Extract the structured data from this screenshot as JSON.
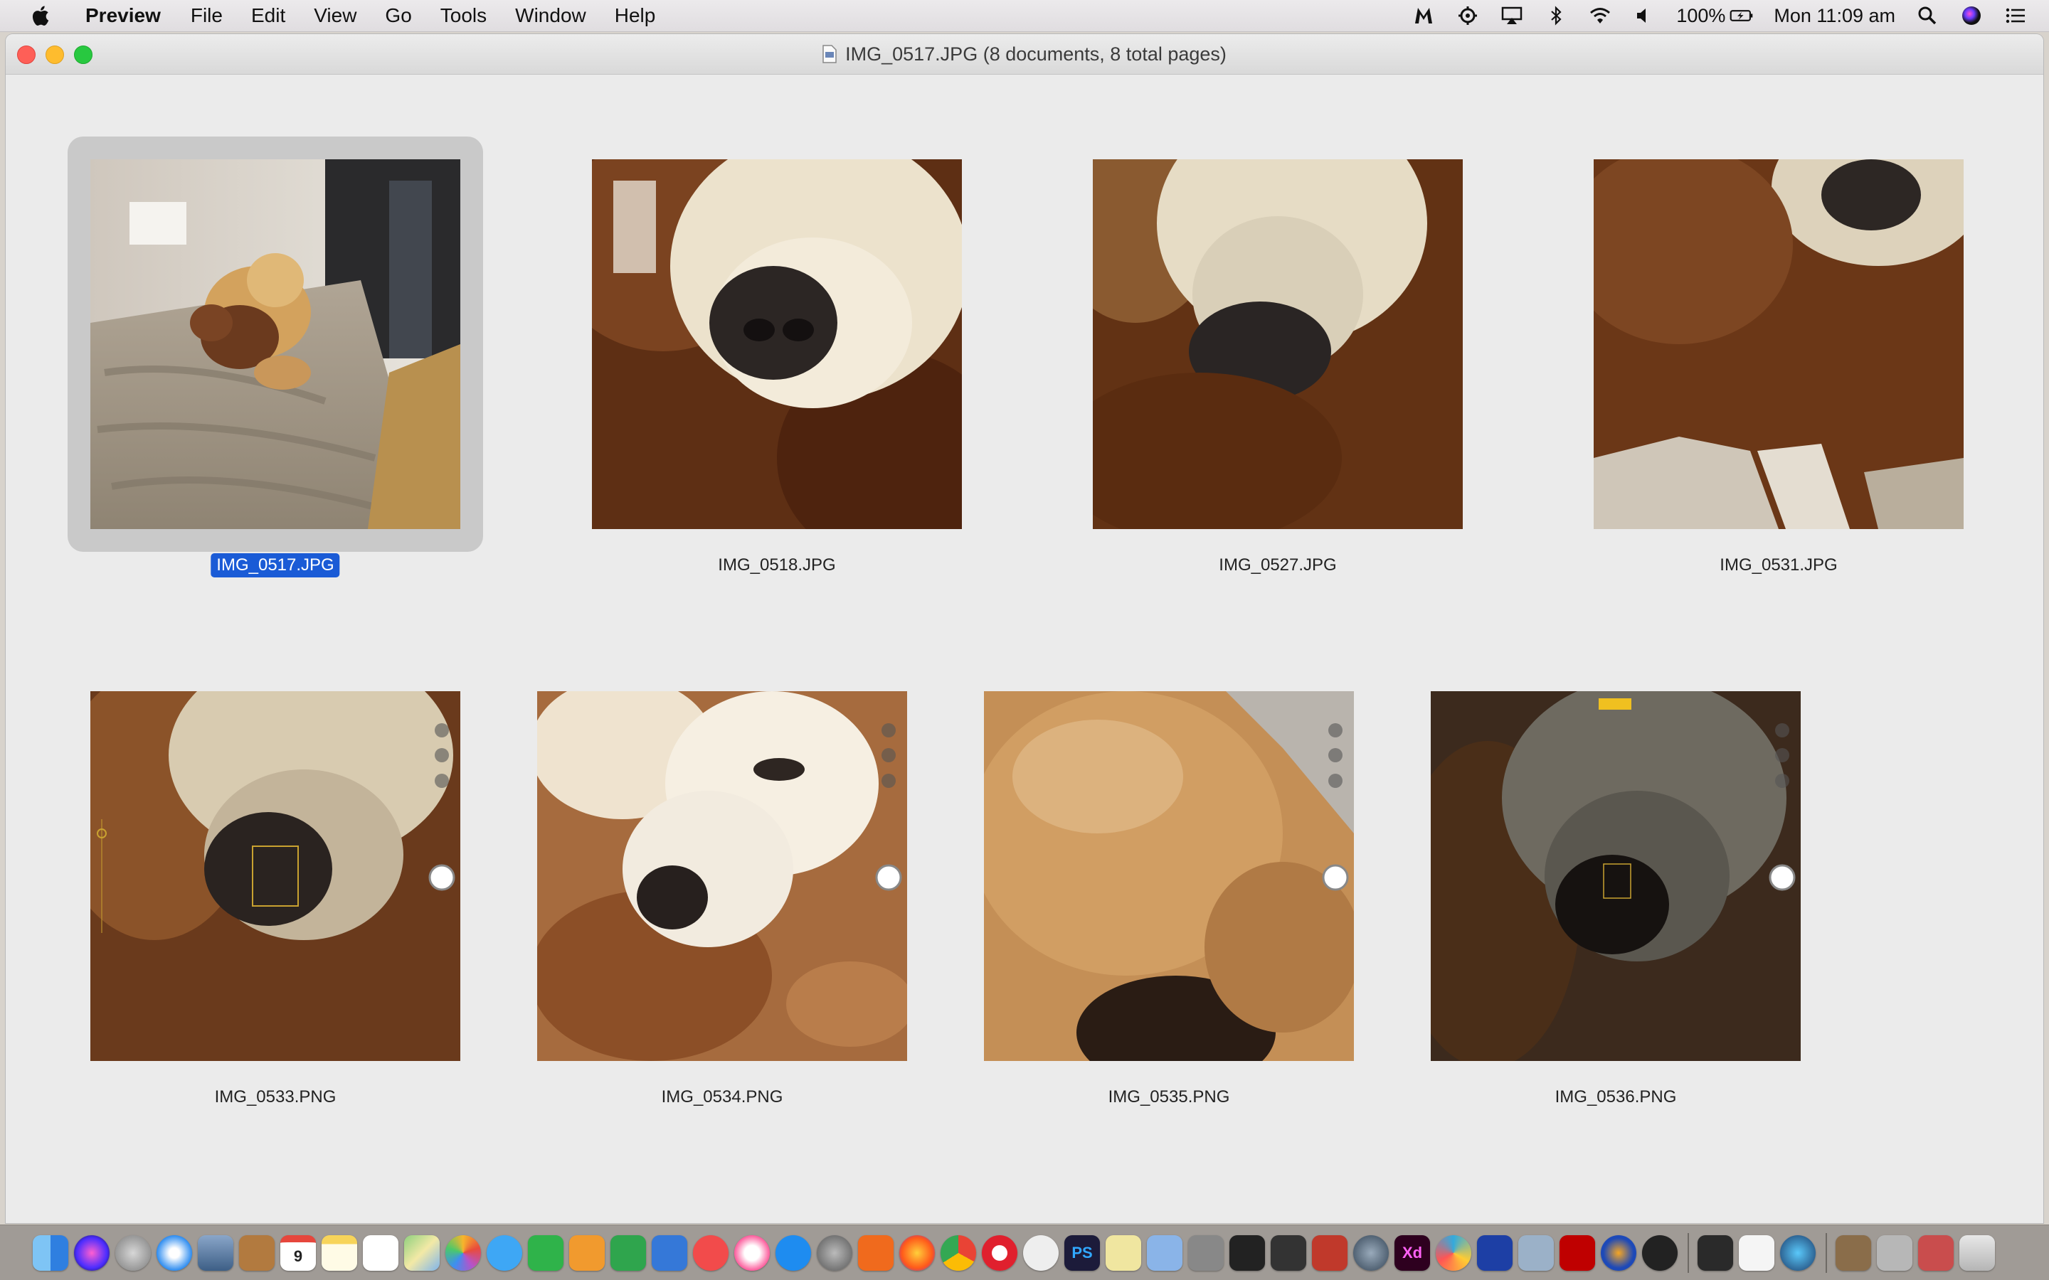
{
  "menubar": {
    "app_name": "Preview",
    "menus": [
      "File",
      "Edit",
      "View",
      "Go",
      "Tools",
      "Window",
      "Help"
    ],
    "battery": "100%",
    "clock": "Mon 11:09 am"
  },
  "window": {
    "title": "IMG_0517.JPG (8 documents, 8 total pages)"
  },
  "thumbnails": [
    {
      "name": "IMG_0517.JPG",
      "selected": true
    },
    {
      "name": "IMG_0518.JPG",
      "selected": false
    },
    {
      "name": "IMG_0527.JPG",
      "selected": false
    },
    {
      "name": "IMG_0531.JPG",
      "selected": false
    },
    {
      "name": "IMG_0533.PNG",
      "selected": false
    },
    {
      "name": "IMG_0534.PNG",
      "selected": false
    },
    {
      "name": "IMG_0535.PNG",
      "selected": false
    },
    {
      "name": "IMG_0536.PNG",
      "selected": false
    }
  ],
  "dock": {
    "apps": [
      "finder",
      "siri",
      "launchpad",
      "safari",
      "preview",
      "notefile",
      "calendar",
      "notes",
      "reminders",
      "maps",
      "photos",
      "messages",
      "facetime",
      "pages",
      "numbers",
      "keynote",
      "news",
      "itunes",
      "app-store",
      "system-preferences",
      "aspect",
      "firefox",
      "chrome",
      "opera",
      "mastodon",
      "photoshop",
      "bbedit",
      "xcode-like",
      "spotlight-tool",
      "terminal",
      "inkscape",
      "mosaic",
      "sphere",
      "adobe-xd",
      "pinwheel",
      "flow",
      "image-capture",
      "filezilla",
      "audacity",
      "fontforge",
      "console",
      "textedit",
      "quicktime"
    ],
    "calendar_day": "9",
    "xd_label": "Xd",
    "ps_label": "PS"
  }
}
